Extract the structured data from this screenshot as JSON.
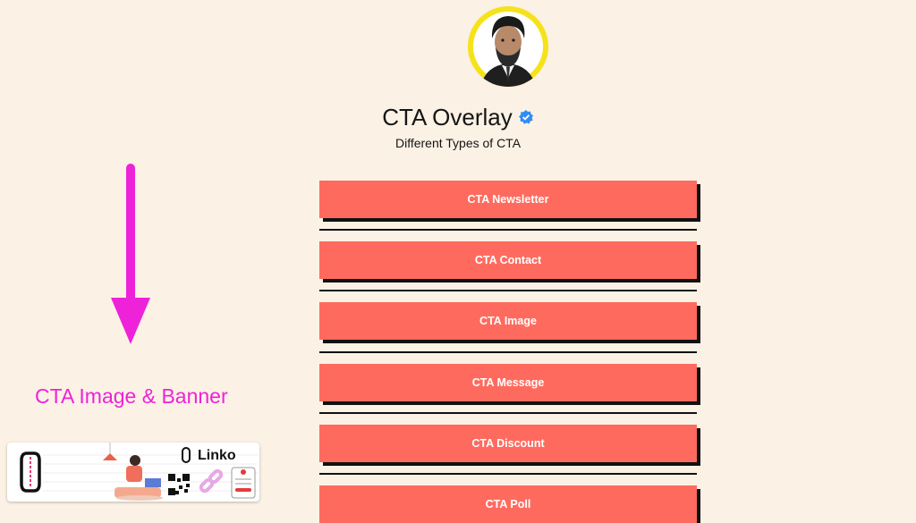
{
  "profile": {
    "title": "CTA Overlay",
    "subtitle": "Different Types of CTA",
    "verified_color": "#2f8cf5",
    "avatar_ring_color": "#f5e21a"
  },
  "buttons": [
    {
      "label": "CTA Newsletter"
    },
    {
      "label": "CTA Contact"
    },
    {
      "label": "CTA Image"
    },
    {
      "label": "CTA Message"
    },
    {
      "label": "CTA Discount"
    },
    {
      "label": "CTA Poll"
    }
  ],
  "annotation": {
    "label": "CTA Image & Banner",
    "color": "#ee22d8"
  },
  "banner": {
    "brand": "Linko"
  },
  "colors": {
    "background": "#fbf1e5",
    "button": "#fe6b5e",
    "button_shadow": "#111111"
  }
}
